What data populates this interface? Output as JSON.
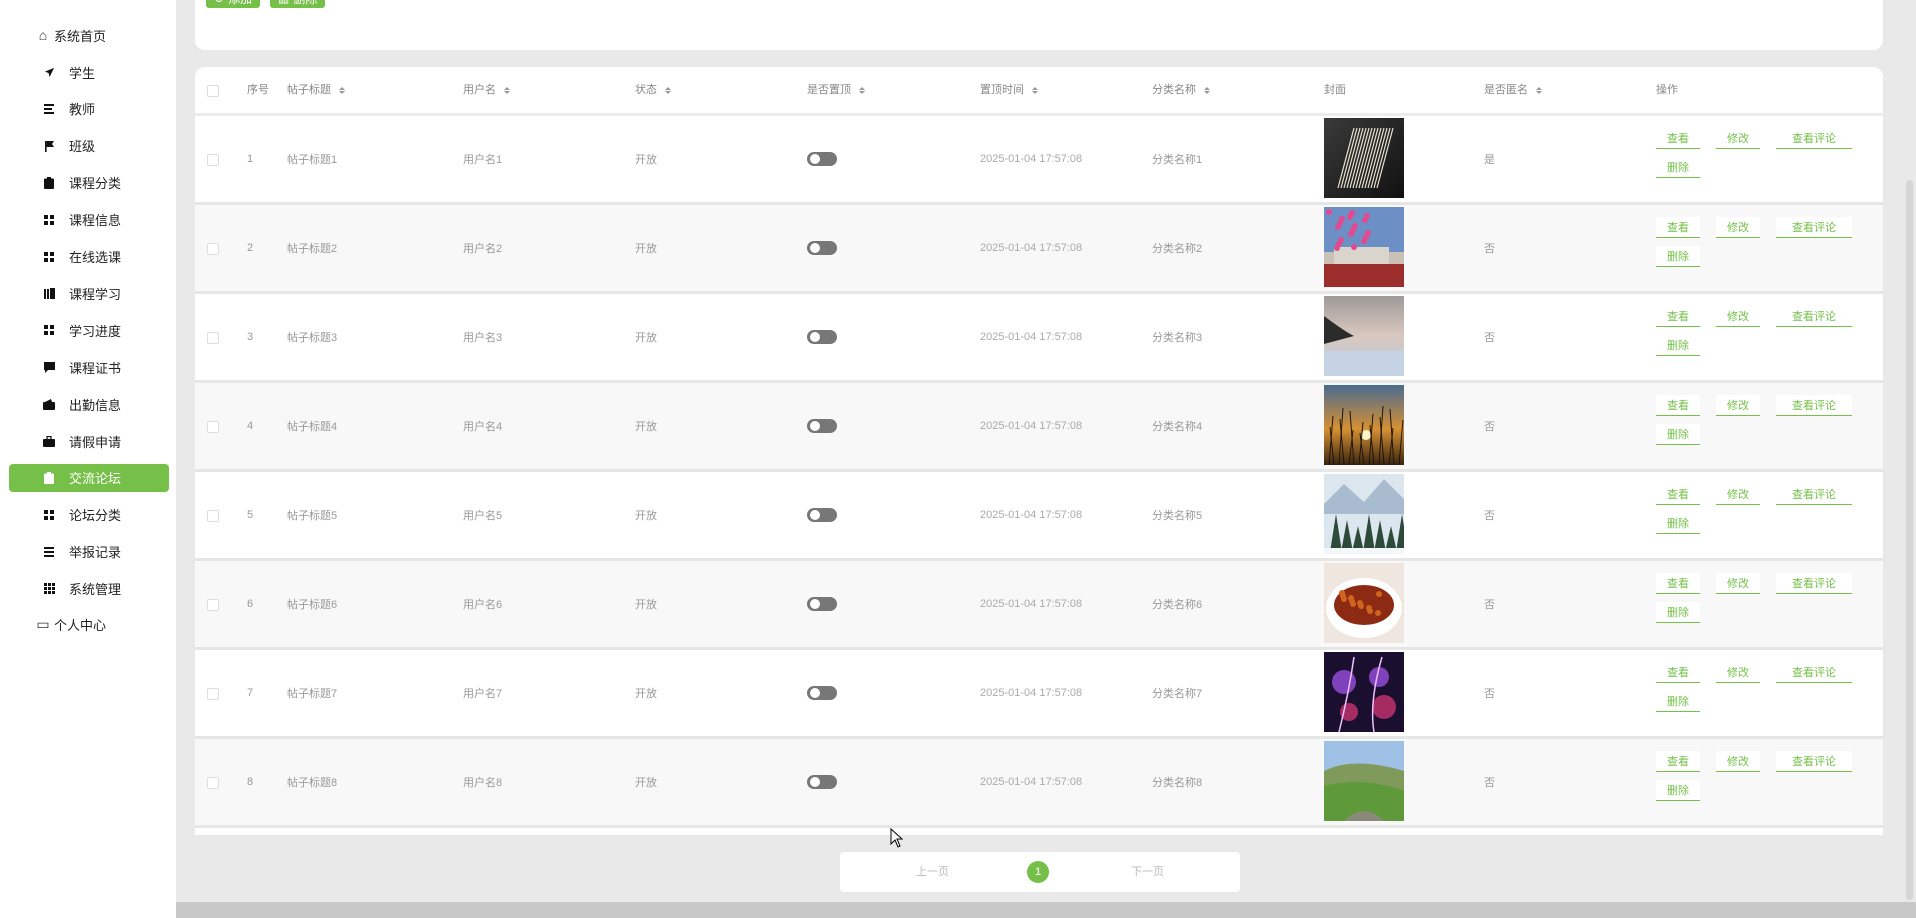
{
  "sidebar": {
    "home": "系统首页",
    "items": [
      {
        "label": "学生",
        "icon": "send-icon"
      },
      {
        "label": "教师",
        "icon": "sliders-icon"
      },
      {
        "label": "班级",
        "icon": "flag-icon"
      },
      {
        "label": "课程分类",
        "icon": "clipboard-icon"
      },
      {
        "label": "课程信息",
        "icon": "grid-icon"
      },
      {
        "label": "在线选课",
        "icon": "grid-icon"
      },
      {
        "label": "课程学习",
        "icon": "library-icon"
      },
      {
        "label": "学习进度",
        "icon": "grid-icon"
      },
      {
        "label": "课程证书",
        "icon": "chat-icon"
      },
      {
        "label": "出勤信息",
        "icon": "wallet-icon"
      },
      {
        "label": "请假申请",
        "icon": "briefcase-icon"
      },
      {
        "label": "交流论坛",
        "icon": "clipboard-icon",
        "active": true
      },
      {
        "label": "论坛分类",
        "icon": "grid-icon"
      },
      {
        "label": "举报记录",
        "icon": "list-icon"
      },
      {
        "label": "系统管理",
        "icon": "apps-icon"
      }
    ],
    "profile": "个人中心"
  },
  "toolbar": {
    "add": "添加",
    "delete": "删除"
  },
  "table": {
    "headers": {
      "index": "序号",
      "title": "帖子标题",
      "username": "用户名",
      "status": "状态",
      "pinned": "是否置顶",
      "pin_time": "置顶时间",
      "category": "分类名称",
      "cover": "封面",
      "anonymous": "是否匿名",
      "actions": "操作"
    },
    "action_labels": {
      "view": "查看",
      "edit": "修改",
      "comments": "查看评论",
      "delete": "删除"
    },
    "rows": [
      {
        "index": "1",
        "title": "帖子标题1",
        "username": "用户名1",
        "status": "开放",
        "pinned": false,
        "pin_time": "2025-01-04 17:57:08",
        "category": "分类名称1",
        "anonymous": "是",
        "cover": "book"
      },
      {
        "index": "2",
        "title": "帖子标题2",
        "username": "用户名2",
        "status": "开放",
        "pinned": false,
        "pin_time": "2025-01-04 17:57:08",
        "category": "分类名称2",
        "anonymous": "否",
        "cover": "blossom-building"
      },
      {
        "index": "3",
        "title": "帖子标题3",
        "username": "用户名3",
        "status": "开放",
        "pinned": false,
        "pin_time": "2025-01-04 17:57:08",
        "category": "分类名称3",
        "anonymous": "否",
        "cover": "winter-lake"
      },
      {
        "index": "4",
        "title": "帖子标题4",
        "username": "用户名4",
        "status": "开放",
        "pinned": false,
        "pin_time": "2025-01-04 17:57:08",
        "category": "分类名称4",
        "anonymous": "否",
        "cover": "sunset-grass"
      },
      {
        "index": "5",
        "title": "帖子标题5",
        "username": "用户名5",
        "status": "开放",
        "pinned": false,
        "pin_time": "2025-01-04 17:57:08",
        "category": "分类名称5",
        "anonymous": "否",
        "cover": "snowy-forest"
      },
      {
        "index": "6",
        "title": "帖子标题6",
        "username": "用户名6",
        "status": "开放",
        "pinned": false,
        "pin_time": "2025-01-04 17:57:08",
        "category": "分类名称6",
        "anonymous": "否",
        "cover": "food-plate"
      },
      {
        "index": "7",
        "title": "帖子标题7",
        "username": "用户名7",
        "status": "开放",
        "pinned": false,
        "pin_time": "2025-01-04 17:57:08",
        "category": "分类名称7",
        "anonymous": "否",
        "cover": "neon-night"
      },
      {
        "index": "8",
        "title": "帖子标题8",
        "username": "用户名8",
        "status": "开放",
        "pinned": false,
        "pin_time": "2025-01-04 17:57:08",
        "category": "分类名称8",
        "anonymous": "否",
        "cover": "green-valley"
      }
    ]
  },
  "pagination": {
    "prev": "上一页",
    "current": "1",
    "next": "下一页"
  },
  "colors": {
    "accent": "#76c04a",
    "toggle_off": "#777777"
  }
}
